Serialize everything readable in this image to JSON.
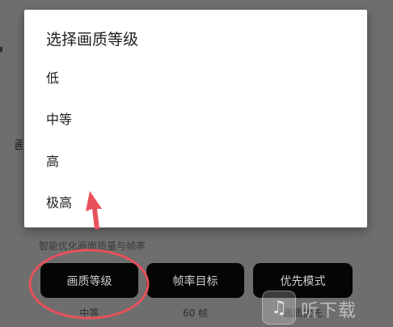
{
  "dialog": {
    "title": "选择画质等级",
    "options": [
      {
        "label": "低"
      },
      {
        "label": "中等"
      },
      {
        "label": "高"
      },
      {
        "label": "极高"
      }
    ]
  },
  "background": {
    "side_label": "画",
    "subtitle": "智能优化画面质量与帧率",
    "buttons": [
      {
        "label": "画质等级",
        "value": "中等"
      },
      {
        "label": "帧率目标",
        "value": "60 帧"
      },
      {
        "label": "优先模式",
        "value": "画质优先"
      }
    ]
  },
  "watermark": {
    "text": "听下载"
  },
  "colors": {
    "annotation_red": "#e8505a",
    "overlay_gray": "#6e6e6e",
    "button_black": "#050505"
  }
}
